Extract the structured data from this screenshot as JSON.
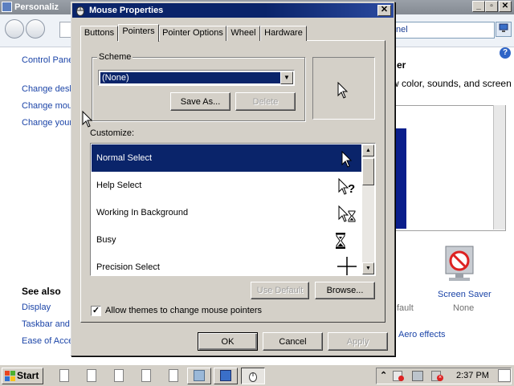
{
  "background_window": {
    "title": "Personaliz",
    "search_value": "nel",
    "nav_links": [
      "Control Pane",
      "Change desk",
      "Change mou",
      "Change your"
    ],
    "heading_fragment": "er",
    "description_fragment": "w color, sounds, and screen",
    "see_also": {
      "heading": "See also",
      "links": [
        "Display",
        "Taskbar and",
        "Ease of Acce"
      ]
    },
    "screen_saver": {
      "label": "Screen Saver",
      "value": "None"
    },
    "fragment_default": "fault",
    "aero_link": "Aero effects",
    "help_glyph": "?"
  },
  "dialog": {
    "title": "Mouse Properties",
    "close_glyph": "✕",
    "tabs": [
      {
        "label": "Buttons"
      },
      {
        "label": "Pointers"
      },
      {
        "label": "Pointer Options"
      },
      {
        "label": "Wheel"
      },
      {
        "label": "Hardware"
      }
    ],
    "active_tab": "Pointers",
    "scheme": {
      "group_label": "Scheme",
      "selected": "(None)",
      "save_as_label": "Save As...",
      "delete_label": "Delete"
    },
    "customize": {
      "label": "Customize:",
      "items": [
        {
          "label": "Normal Select",
          "cursor_icon": "arrow-cursor-icon"
        },
        {
          "label": "Help Select",
          "cursor_icon": "help-cursor-icon"
        },
        {
          "label": "Working In Background",
          "cursor_icon": "working-cursor-icon"
        },
        {
          "label": "Busy",
          "cursor_icon": "hourglass-icon"
        },
        {
          "label": "Precision Select",
          "cursor_icon": "crosshair-icon"
        }
      ],
      "selected_index": 0
    },
    "use_default_label": "Use Default",
    "browse_label": "Browse...",
    "allow_themes": {
      "label": "Allow themes to change mouse pointers",
      "checked": true
    },
    "ok_label": "OK",
    "cancel_label": "Cancel",
    "apply_label": "Apply"
  },
  "taskbar": {
    "start_label": "Start",
    "clock": "2:37 PM"
  },
  "colors": {
    "title_blue": "#0a246a",
    "selection_blue": "#0a246a",
    "face_gray": "#d4d0c8",
    "link_blue": "#1c45a8"
  }
}
